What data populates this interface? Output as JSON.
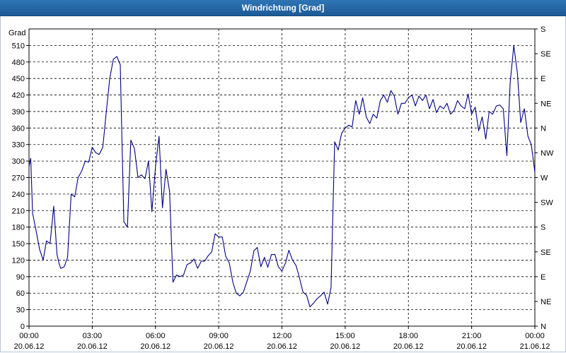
{
  "window": {
    "title": "Windrichtung [Grad]"
  },
  "chart_data": {
    "type": "line",
    "title": "Windrichtung [Grad]",
    "ylabel": "Grad",
    "ylim": [
      0,
      540
    ],
    "yticks": [
      0,
      30,
      60,
      90,
      120,
      150,
      180,
      210,
      240,
      270,
      300,
      330,
      360,
      390,
      420,
      450,
      480,
      510
    ],
    "y2_ticks": [
      {
        "value": 0,
        "label": "N"
      },
      {
        "value": 45,
        "label": "NE"
      },
      {
        "value": 90,
        "label": "E"
      },
      {
        "value": 135,
        "label": "SE"
      },
      {
        "value": 180,
        "label": "S"
      },
      {
        "value": 225,
        "label": "SW"
      },
      {
        "value": 270,
        "label": "W"
      },
      {
        "value": 315,
        "label": "NW"
      },
      {
        "value": 360,
        "label": "N"
      },
      {
        "value": 405,
        "label": "NE"
      },
      {
        "value": 450,
        "label": "E"
      },
      {
        "value": 495,
        "label": "SE"
      },
      {
        "value": 540,
        "label": "S"
      }
    ],
    "xlim_hours": [
      0,
      24
    ],
    "xticks": [
      {
        "hour": 0,
        "time": "00:00",
        "date": "20.06.12"
      },
      {
        "hour": 3,
        "time": "03:00",
        "date": "20.06.12"
      },
      {
        "hour": 6,
        "time": "06:00",
        "date": "20.06.12"
      },
      {
        "hour": 9,
        "time": "09:00",
        "date": "20.06.12"
      },
      {
        "hour": 12,
        "time": "12:00",
        "date": "20.06.12"
      },
      {
        "hour": 15,
        "time": "15:00",
        "date": "20.06.12"
      },
      {
        "hour": 18,
        "time": "18:00",
        "date": "20.06.12"
      },
      {
        "hour": 21,
        "time": "21:00",
        "date": "20.06.12"
      },
      {
        "hour": 24,
        "time": "00:00",
        "date": "21.06.12"
      }
    ],
    "grid": true,
    "line_color": "#000080",
    "series": [
      {
        "x": [
          0.0,
          0.08,
          0.17,
          0.33,
          0.5,
          0.67,
          0.83,
          1.0,
          1.17,
          1.33,
          1.42,
          1.5,
          1.67,
          1.83,
          2.0,
          2.17,
          2.33,
          2.5,
          2.67,
          2.83,
          3.0,
          3.17,
          3.33,
          3.5,
          3.67,
          3.83,
          4.0,
          4.17,
          4.33,
          4.42,
          4.5,
          4.67,
          4.83,
          5.0,
          5.17,
          5.33,
          5.5,
          5.67,
          5.83,
          6.0,
          6.17,
          6.33,
          6.5,
          6.67,
          6.83,
          7.0,
          7.17,
          7.33,
          7.5,
          7.67,
          7.83,
          8.0,
          8.17,
          8.33,
          8.5,
          8.67,
          8.83,
          9.0,
          9.17,
          9.33,
          9.5,
          9.67,
          9.83,
          10.0,
          10.17,
          10.33,
          10.5,
          10.67,
          10.83,
          11.0,
          11.17,
          11.33,
          11.5,
          11.67,
          11.83,
          12.0,
          12.17,
          12.33,
          12.5,
          12.67,
          12.83,
          13.0,
          13.17,
          13.33,
          13.5,
          13.67,
          13.83,
          14.0,
          14.17,
          14.33,
          14.5,
          14.67,
          14.83,
          15.0,
          15.17,
          15.33,
          15.5,
          15.67,
          15.83,
          16.0,
          16.17,
          16.33,
          16.5,
          16.67,
          16.83,
          17.0,
          17.17,
          17.33,
          17.5,
          17.67,
          17.83,
          18.0,
          18.17,
          18.33,
          18.5,
          18.67,
          18.83,
          19.0,
          19.17,
          19.33,
          19.5,
          19.67,
          19.83,
          20.0,
          20.17,
          20.33,
          20.5,
          20.67,
          20.83,
          21.0,
          21.17,
          21.33,
          21.5,
          21.67,
          21.83,
          22.0,
          22.17,
          22.33,
          22.5,
          22.67,
          22.83,
          23.0,
          23.17,
          23.33,
          23.5,
          23.67,
          23.83,
          24.0
        ],
        "y": [
          290,
          305,
          205,
          175,
          140,
          120,
          155,
          150,
          218,
          130,
          115,
          105,
          108,
          125,
          240,
          235,
          270,
          282,
          300,
          298,
          325,
          315,
          312,
          325,
          390,
          450,
          485,
          490,
          475,
          320,
          190,
          180,
          338,
          323,
          270,
          275,
          268,
          300,
          208,
          290,
          345,
          215,
          285,
          245,
          80,
          93,
          90,
          93,
          112,
          115,
          122,
          105,
          118,
          118,
          128,
          135,
          168,
          162,
          162,
          127,
          115,
          80,
          60,
          55,
          62,
          80,
          100,
          137,
          143,
          108,
          125,
          107,
          130,
          130,
          108,
          100,
          115,
          138,
          120,
          110,
          88,
          62,
          56,
          35,
          42,
          50,
          55,
          62,
          40,
          70,
          335,
          320,
          350,
          360,
          365,
          362,
          410,
          385,
          415,
          380,
          368,
          385,
          378,
          410,
          420,
          407,
          428,
          418,
          385,
          405,
          405,
          415,
          420,
          400,
          418,
          410,
          420,
          395,
          412,
          388,
          400,
          395,
          405,
          385,
          392,
          410,
          400,
          395,
          422,
          385,
          398,
          355,
          380,
          340,
          390,
          385,
          400,
          402,
          395,
          310,
          442,
          510,
          460,
          370,
          395,
          345,
          330,
          280
        ]
      }
    ]
  }
}
